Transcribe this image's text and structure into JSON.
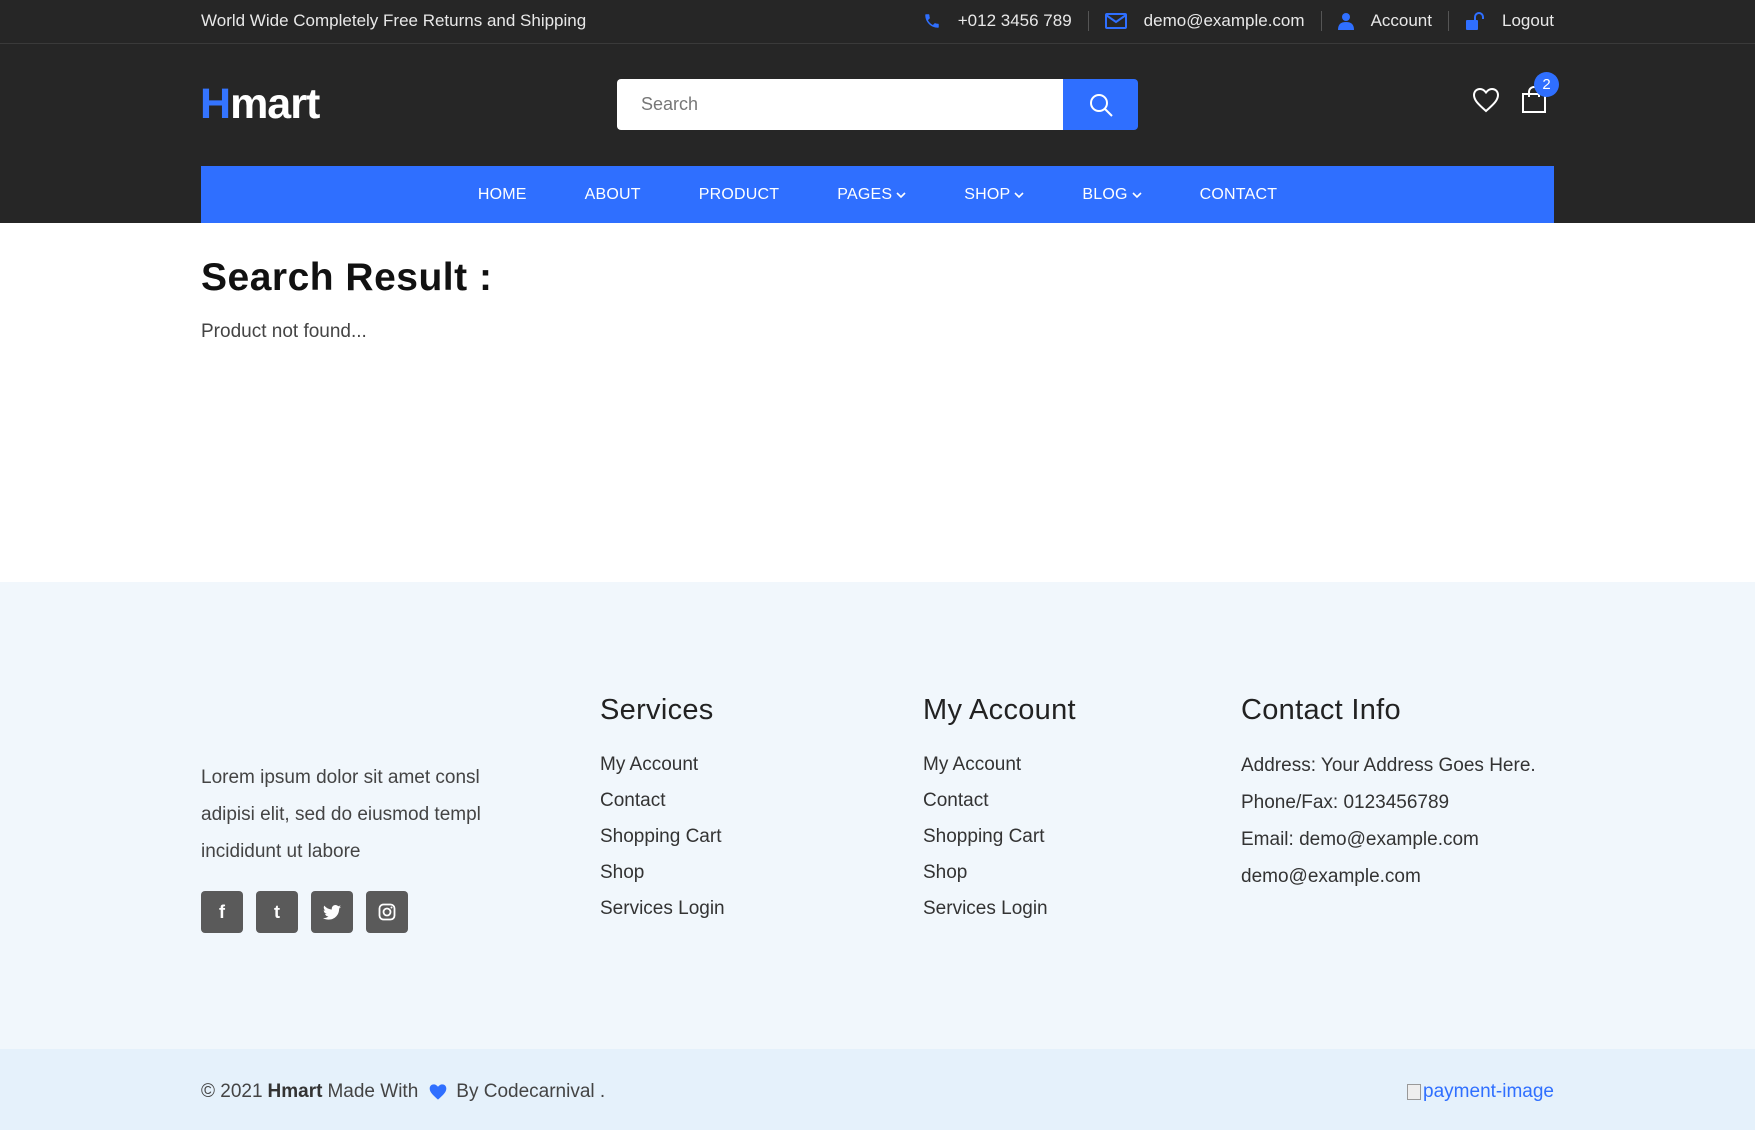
{
  "topbar": {
    "promo": "World Wide Completely Free Returns and Shipping",
    "phone": "+012 3456 789",
    "email": "demo@example.com",
    "account": "Account",
    "logout": "Logout"
  },
  "header": {
    "logo_first": "H",
    "logo_rest": "mart",
    "search_placeholder": "Search",
    "cart_count": "2"
  },
  "nav": {
    "items": [
      {
        "label": "HOME"
      },
      {
        "label": "ABOUT"
      },
      {
        "label": "PRODUCT"
      },
      {
        "label": "PAGES"
      },
      {
        "label": "SHOP"
      },
      {
        "label": "BLOG"
      },
      {
        "label": "CONTACT"
      }
    ]
  },
  "main": {
    "title": "Search Result :",
    "message": "Product not found..."
  },
  "footer": {
    "about_text": "Lorem ipsum dolor sit amet consl adipisi elit, sed do eiusmod templ incididunt ut labore",
    "social": [
      "f",
      "t",
      "twitter",
      "instagram"
    ],
    "services": {
      "heading": "Services",
      "links": [
        "My Account",
        "Contact",
        "Shopping Cart",
        "Shop",
        "Services Login"
      ]
    },
    "my_account": {
      "heading": "My Account",
      "links": [
        "My Account",
        "Contact",
        "Shopping Cart",
        "Shop",
        "Services Login"
      ]
    },
    "contact_info": {
      "heading": "Contact Info",
      "address": "Address: Your Address Goes Here.",
      "phone": "Phone/Fax: 0123456789",
      "email": "Email: demo@example.com",
      "email2": "demo@example.com"
    }
  },
  "bottom": {
    "copy_prefix": "© 2021",
    "brand": "Hmart",
    "made_with": "Made With",
    "by": "By Codecarnival .",
    "payment_alt": "payment-image"
  },
  "colors": {
    "accent": "#2f6fff",
    "dark_bg": "#262626",
    "footer_bg": "#f1f7fc"
  }
}
